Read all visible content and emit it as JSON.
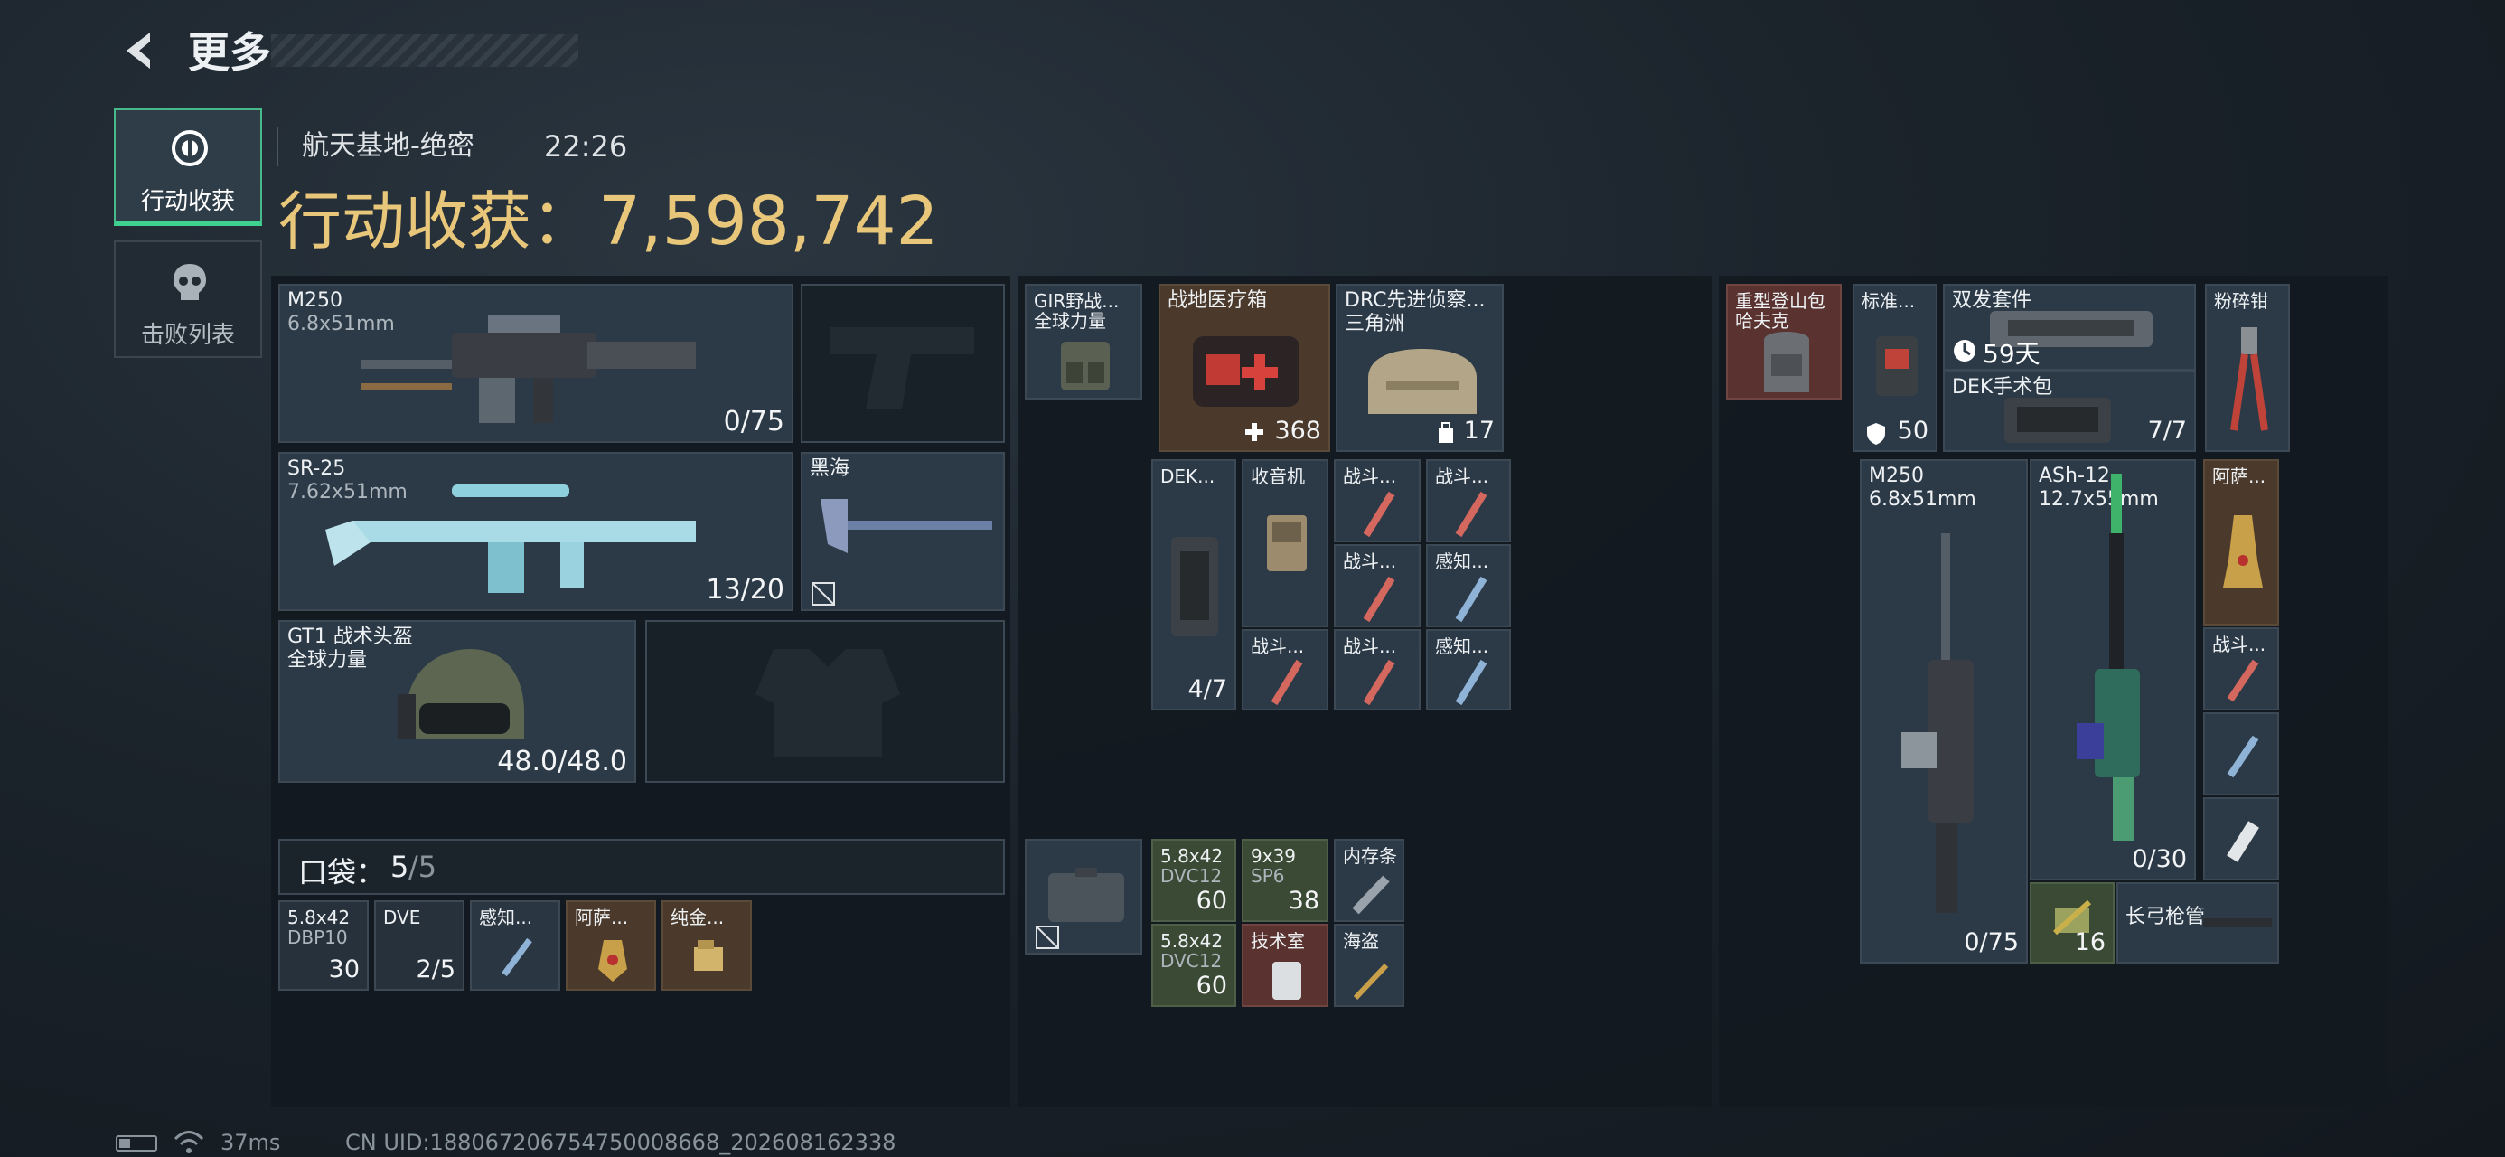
{
  "header": {
    "title": "更多"
  },
  "sidebar": {
    "tabs": [
      {
        "label": "行动收获"
      },
      {
        "label": "击败列表"
      }
    ]
  },
  "mission": {
    "map": "航天基地-绝密",
    "time": "22:26",
    "loot_label": "行动收获：",
    "loot_value": "7,598,742"
  },
  "loadout": {
    "primary": {
      "name": "M250",
      "caliber": "6.8x51mm",
      "ammo": "0/75"
    },
    "secondary": {
      "name": "SR-25",
      "caliber": "7.62x51mm",
      "ammo": "13/20"
    },
    "melee": {
      "name": "黑海"
    },
    "helmet": {
      "name": "GT1 战术头盔",
      "brand": "全球力量",
      "durability": "48.0/48.0"
    },
    "pocket": {
      "label": "口袋：",
      "count": "5",
      "capacity": "/5"
    },
    "pocket_items": [
      {
        "name": "5.8x42",
        "sub": "DBP10",
        "count": "30"
      },
      {
        "name": "DVE",
        "count": "2/5"
      },
      {
        "name": "感知..."
      },
      {
        "name": "阿萨..."
      },
      {
        "name": "纯金..."
      }
    ]
  },
  "chest": {
    "rig": {
      "name": "GIR野战...",
      "brand": "全球力量"
    },
    "medkit": {
      "name": "战地医疗箱",
      "count": "368"
    },
    "backpack": {
      "name": "DRC先进侦察...",
      "brand": "三角洲",
      "count": "17"
    },
    "items": [
      {
        "name": "DEK...",
        "count": "4/7"
      },
      {
        "name": "收音机"
      },
      {
        "name": "战斗..."
      },
      {
        "name": "战斗..."
      },
      {
        "name": "战斗..."
      },
      {
        "name": "感知..."
      },
      {
        "name": "战斗..."
      },
      {
        "name": "战斗..."
      },
      {
        "name": "感知..."
      }
    ],
    "secure": [
      {
        "name": "5.8x42",
        "sub": "DVC12",
        "count": "60"
      },
      {
        "name": "9x39",
        "sub": "SP6",
        "count": "38"
      },
      {
        "name": "内存条"
      },
      {
        "name": "5.8x42",
        "sub": "DVC12",
        "count": "60"
      },
      {
        "name": "技术室"
      },
      {
        "name": "海盗"
      }
    ]
  },
  "backpack_contents": {
    "bag": {
      "name": "重型登山包",
      "brand": "哈夫克"
    },
    "std": {
      "name": "标准...",
      "count": "50"
    },
    "twin": {
      "name": "双发套件",
      "timer": "59天"
    },
    "dek": {
      "name": "DEK手术包",
      "count": "7/7"
    },
    "pliers": {
      "name": "粉碎钳"
    },
    "m250": {
      "name": "M250",
      "caliber": "6.8x51mm",
      "ammo": "0/75"
    },
    "ash": {
      "name": "ASh-12",
      "caliber": "12.7x55mm",
      "ammo": "0/30"
    },
    "asa": {
      "name": "阿萨..."
    },
    "combat": {
      "name": "战斗..."
    },
    "ammo_box": {
      "count": "16"
    },
    "barrel": {
      "name": "长弓枪管"
    }
  },
  "status": {
    "ping": "37ms",
    "uid": "CN UID:188067206754750008668_202608162338"
  }
}
